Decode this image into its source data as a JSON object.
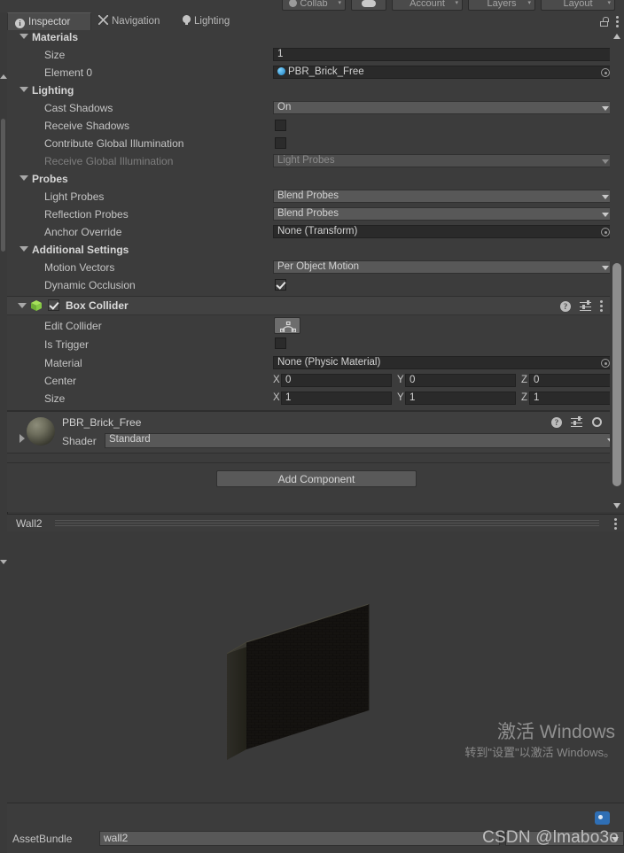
{
  "toolbar": {
    "collab": "Collab",
    "cloud_icon": "cloud-icon",
    "account": "Account",
    "layers": "Layers",
    "layout": "Layout"
  },
  "tabs": [
    {
      "label": "Inspector",
      "icon": "info-icon",
      "active": true
    },
    {
      "label": "Navigation",
      "icon": "navigation-icon",
      "active": false
    },
    {
      "label": "Lighting",
      "icon": "lightbulb-icon",
      "active": false
    }
  ],
  "tab_right_icons": [
    "lock-icon",
    "kebab-menu-icon"
  ],
  "sections": {
    "materials": {
      "title": "Materials",
      "size_label": "Size",
      "size_value": "1",
      "element_label": "Element 0",
      "element_value": "PBR_Brick_Free"
    },
    "lighting": {
      "title": "Lighting",
      "cast_shadows_label": "Cast Shadows",
      "cast_shadows_value": "On",
      "receive_shadows_label": "Receive Shadows",
      "receive_shadows_checked": false,
      "contribute_gi_label": "Contribute Global Illumination",
      "contribute_gi_checked": false,
      "receive_gi_label": "Receive Global Illumination",
      "receive_gi_value": "Light Probes",
      "receive_gi_disabled": true
    },
    "probes": {
      "title": "Probes",
      "light_probes_label": "Light Probes",
      "light_probes_value": "Blend Probes",
      "reflection_probes_label": "Reflection Probes",
      "reflection_probes_value": "Blend Probes",
      "anchor_override_label": "Anchor Override",
      "anchor_override_value": "None (Transform)"
    },
    "additional": {
      "title": "Additional Settings",
      "motion_vectors_label": "Motion Vectors",
      "motion_vectors_value": "Per Object Motion",
      "dynamic_occlusion_label": "Dynamic Occlusion",
      "dynamic_occlusion_checked": true
    }
  },
  "box_collider": {
    "title": "Box Collider",
    "enabled": true,
    "header_icons": [
      "help-icon",
      "preset-icon",
      "kebab-menu-icon"
    ],
    "edit_collider_label": "Edit Collider",
    "is_trigger_label": "Is Trigger",
    "is_trigger_checked": false,
    "material_label": "Material",
    "material_value": "None (Physic Material)",
    "center_label": "Center",
    "center": {
      "x_axis": "X",
      "x": "0",
      "y_axis": "Y",
      "y": "0",
      "z_axis": "Z",
      "z": "0"
    },
    "size_label": "Size",
    "size": {
      "x_axis": "X",
      "x": "1",
      "y_axis": "Y",
      "y": "1",
      "z_axis": "Z",
      "z": "1"
    }
  },
  "material_panel": {
    "name": "PBR_Brick_Free",
    "shader_label": "Shader",
    "shader_value": "Standard",
    "header_icons": [
      "help-icon",
      "preset-icon",
      "gear-icon"
    ]
  },
  "add_component_label": "Add Component",
  "preview": {
    "object_name": "Wall2",
    "menu_icon": "kebab-menu-icon"
  },
  "asset_bundle": {
    "label": "AssetBundle",
    "name_value": "wall2",
    "variant_value": ""
  },
  "watermarks": {
    "windows_title": "激活 Windows",
    "windows_subtitle": "转到\"设置\"以激活 Windows。",
    "csdn": "CSDN @lmabo3o"
  },
  "colors": {
    "background": "#383838",
    "panel": "#3c3c3c",
    "field": "#2a2a2a",
    "dropdown": "#585858",
    "text": "#c4c4c4",
    "accent_blue": "#2f6fb5",
    "collider_green": "#8ccf4c"
  }
}
